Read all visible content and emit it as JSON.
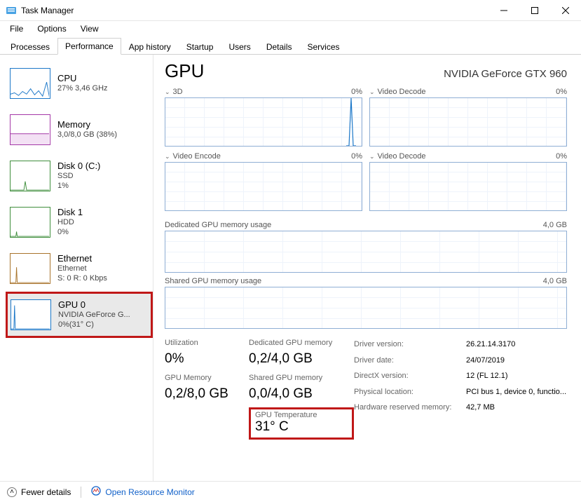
{
  "window": {
    "title": "Task Manager"
  },
  "menu": {
    "file": "File",
    "options": "Options",
    "view": "View"
  },
  "tabs": {
    "processes": "Processes",
    "performance": "Performance",
    "apphistory": "App history",
    "startup": "Startup",
    "users": "Users",
    "details": "Details",
    "services": "Services"
  },
  "sidebar": {
    "items": [
      {
        "name": "CPU",
        "l1": "27% 3,46 GHz",
        "l2": ""
      },
      {
        "name": "Memory",
        "l1": "3,0/8,0 GB (38%)",
        "l2": ""
      },
      {
        "name": "Disk 0 (C:)",
        "l1": "SSD",
        "l2": "1%"
      },
      {
        "name": "Disk 1",
        "l1": "HDD",
        "l2": "0%"
      },
      {
        "name": "Ethernet",
        "l1": "Ethernet",
        "l2": "S: 0 R: 0 Kbps"
      },
      {
        "name": "GPU 0",
        "l1": "NVIDIA GeForce G...",
        "l2": "0%(31° C)"
      }
    ]
  },
  "main": {
    "heading": "GPU",
    "model": "NVIDIA GeForce GTX 960",
    "engines": [
      {
        "name": "3D",
        "pct": "0%"
      },
      {
        "name": "Video Decode",
        "pct": "0%"
      },
      {
        "name": "Video Encode",
        "pct": "0%"
      },
      {
        "name": "Video Decode",
        "pct": "0%"
      }
    ],
    "dedicated": {
      "label": "Dedicated GPU memory usage",
      "max": "4,0 GB"
    },
    "shared": {
      "label": "Shared GPU memory usage",
      "max": "4,0 GB"
    },
    "stats": {
      "util_label": "Utilization",
      "util": "0%",
      "gpumem_label": "GPU Memory",
      "gpumem": "0,2/8,0 GB",
      "ded_label": "Dedicated GPU memory",
      "ded": "0,2/4,0 GB",
      "sh_label": "Shared GPU memory",
      "sh": "0,0/4,0 GB",
      "temp_label": "GPU Temperature",
      "temp": "31° C"
    },
    "info": {
      "drvver_k": "Driver version:",
      "drvver_v": "26.21.14.3170",
      "drvdate_k": "Driver date:",
      "drvdate_v": "24/07/2019",
      "dx_k": "DirectX version:",
      "dx_v": "12 (FL 12.1)",
      "loc_k": "Physical location:",
      "loc_v": "PCI bus 1, device 0, functio...",
      "hw_k": "Hardware reserved memory:",
      "hw_v": "42,7 MB"
    }
  },
  "footer": {
    "fewer": "Fewer details",
    "orm": "Open Resource Monitor"
  }
}
